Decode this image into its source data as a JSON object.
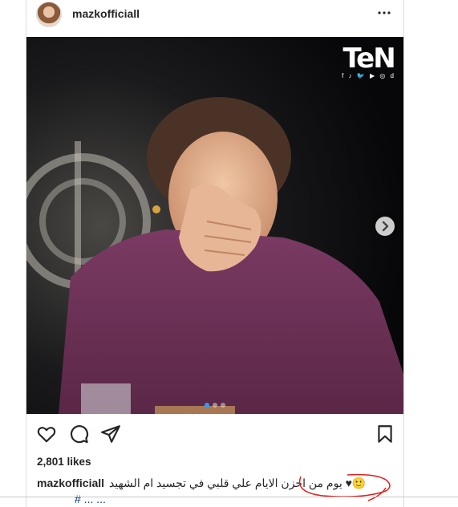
{
  "header": {
    "username": "mazkofficiall",
    "more_icon": "more-horizontal-icon"
  },
  "media": {
    "watermark": "TeN",
    "watermark_social": "f  ♪  🐦  ▶  ◎  d",
    "carousel_position": 1,
    "carousel_count": 3,
    "next_icon": "chevron-right-icon"
  },
  "actions": {
    "like_icon": "heart-icon",
    "comment_icon": "comment-icon",
    "share_icon": "paper-plane-icon",
    "save_icon": "bookmark-icon"
  },
  "likes": "2,801 likes",
  "caption": {
    "username": "mazkofficiall",
    "text": "يوم من احزن الايام علي قلبي في تجسيد ام الشهيد ♥🙂",
    "line2": "# ... ..."
  },
  "colors": {
    "border": "#dbdbdb",
    "text": "#262626",
    "annotation": "#e0201d",
    "carousel_active": "#2f9bf7"
  }
}
